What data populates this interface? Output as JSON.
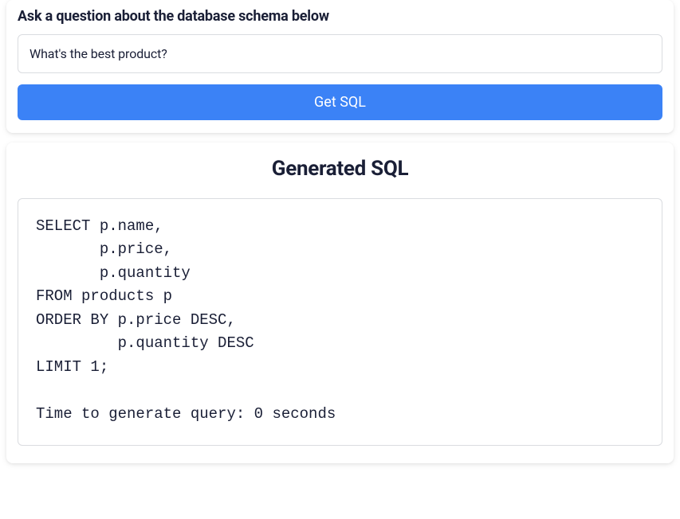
{
  "form": {
    "prompt_label": "Ask a question about the database schema below",
    "question_value": "What's the best product?",
    "submit_label": "Get SQL"
  },
  "result": {
    "heading": "Generated SQL",
    "sql": "SELECT p.name,\n       p.price,\n       p.quantity\nFROM products p\nORDER BY p.price DESC,\n         p.quantity DESC\nLIMIT 1;\n\nTime to generate query: 0 seconds"
  }
}
